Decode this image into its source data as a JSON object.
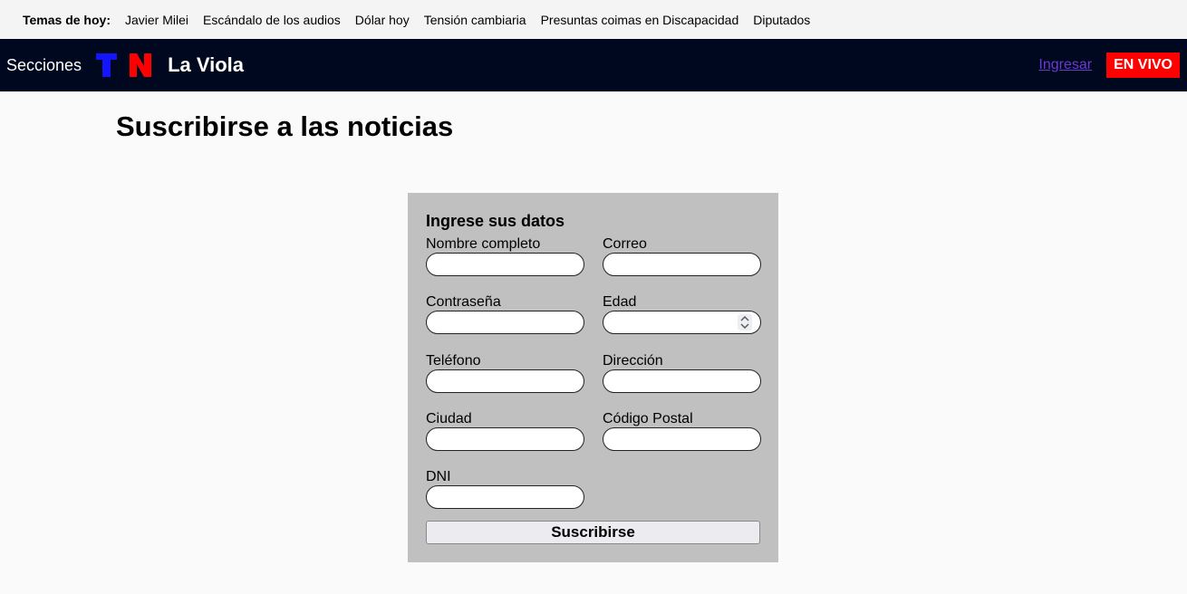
{
  "topics_bar": {
    "label": "Temas de hoy:",
    "items": [
      "Javier Milei",
      "Escándalo de los audios",
      "Dólar hoy",
      "Tensión cambiaria",
      "Presuntas coimas en Discapacidad",
      "Diputados"
    ]
  },
  "navbar": {
    "secciones": "Secciones",
    "logo_letters": [
      "T",
      "N"
    ],
    "section_title": "La Viola",
    "login_link": "Ingresar",
    "live_button": "EN VIVO"
  },
  "page": {
    "title": "Suscribirse a las noticias"
  },
  "form": {
    "title": "Ingrese sus datos",
    "fields": {
      "nombre": "Nombre completo",
      "correo": "Correo",
      "contrasena": "Contraseña",
      "edad": "Edad",
      "telefono": "Teléfono",
      "direccion": "Dirección",
      "ciudad": "Ciudad",
      "codigo_postal": "Código Postal",
      "dni": "DNI"
    },
    "submit_label": "Suscribirse"
  },
  "colors": {
    "navbar_bg": "#000820",
    "logo_t": "#1414ff",
    "logo_n": "#ff0000",
    "live_bg": "#ff0000",
    "form_bg": "#c0c0c0"
  }
}
